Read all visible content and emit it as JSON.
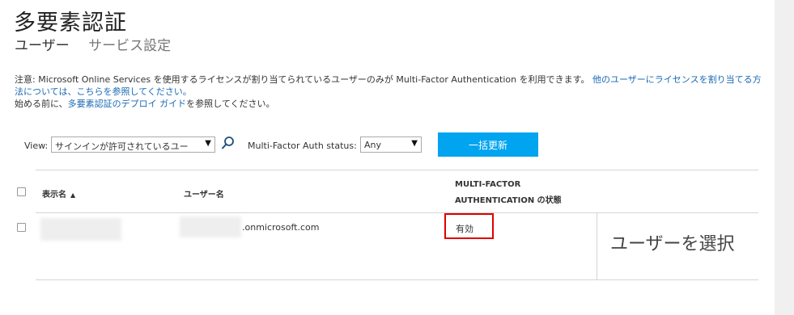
{
  "page": {
    "title": "多要素認証",
    "tabs": [
      {
        "label": "ユーザー",
        "active": true
      },
      {
        "label": "サービス設定",
        "active": false
      }
    ]
  },
  "notice": {
    "line1_prefix": "注意: Microsoft Online Services を使用するライセンスが割り当てられているユーザーのみが Multi-Factor Authentication を利用できます。",
    "line1_link": "他のユーザーにライセンスを割り当てる方法については、こちらを参照してください。",
    "line2_prefix": "始める前に、",
    "line2_link": "多要素認証のデプロイ ガイド",
    "line2_suffix": "を参照してください。"
  },
  "filters": {
    "view_label": "View:",
    "view_value": "サインインが許可されているユー",
    "status_label": "Multi-Factor Auth status:",
    "status_value": "Any",
    "bulk_update_label": "一括更新"
  },
  "table": {
    "headers": {
      "display_name": "表示名",
      "user_name": "ユーザー名",
      "mfa_status_line1": "MULTI-FACTOR",
      "mfa_status_line2": "AUTHENTICATION の状態"
    },
    "rows": [
      {
        "display_name": "",
        "user_name_suffix": ".onmicrosoft.com",
        "mfa_status": "有効"
      }
    ]
  },
  "side_panel": {
    "text": "ユーザーを選択"
  },
  "colors": {
    "accent": "#00a4ef",
    "link": "#1a69b5",
    "highlight_border": "#e00000",
    "side_strip": "#f0f0f0"
  },
  "icons": {
    "search": "search-icon",
    "sort_ascending": "sort-ascending-icon",
    "dropdown": "chevron-down-icon"
  }
}
